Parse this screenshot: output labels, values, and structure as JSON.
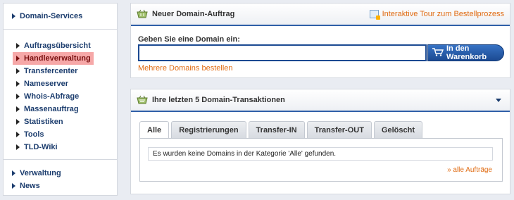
{
  "sidebar": {
    "header": "Domain-Services",
    "items": [
      {
        "label": "Auftragsübersicht",
        "active": false
      },
      {
        "label": "Handleverwaltung",
        "active": true
      },
      {
        "label": "Transfercenter",
        "active": false
      },
      {
        "label": "Nameserver",
        "active": false
      },
      {
        "label": "Whois-Abfrage",
        "active": false
      },
      {
        "label": "Massenauftrag",
        "active": false
      },
      {
        "label": "Statistiken",
        "active": false
      },
      {
        "label": "Tools",
        "active": false
      },
      {
        "label": "TLD-Wiki",
        "active": false
      }
    ],
    "bottom_items": [
      {
        "label": "Verwaltung"
      },
      {
        "label": "News"
      }
    ]
  },
  "order_panel": {
    "title": "Neuer Domain-Auftrag",
    "tour_link": "Interaktive Tour zum Bestellprozess",
    "domain_label": "Geben Sie eine Domain ein:",
    "domain_value": "",
    "cart_button": "In den Warenkorb",
    "multi_link": "Mehrere Domains bestellen"
  },
  "transactions_panel": {
    "title": "Ihre letzten 5 Domain-Transaktionen",
    "tabs": [
      {
        "label": "Alle",
        "active": true
      },
      {
        "label": "Registrierungen",
        "active": false
      },
      {
        "label": "Transfer-IN",
        "active": false
      },
      {
        "label": "Transfer-OUT",
        "active": false
      },
      {
        "label": "Gelöscht",
        "active": false
      }
    ],
    "empty_message": "Es wurden keine Domains in der Kategorie 'Alle' gefunden.",
    "all_orders_link": "» alle Aufträge"
  },
  "colors": {
    "accent_blue": "#1c4a92",
    "link_orange": "#e06b12",
    "active_item_bg": "#f6a8a8"
  }
}
